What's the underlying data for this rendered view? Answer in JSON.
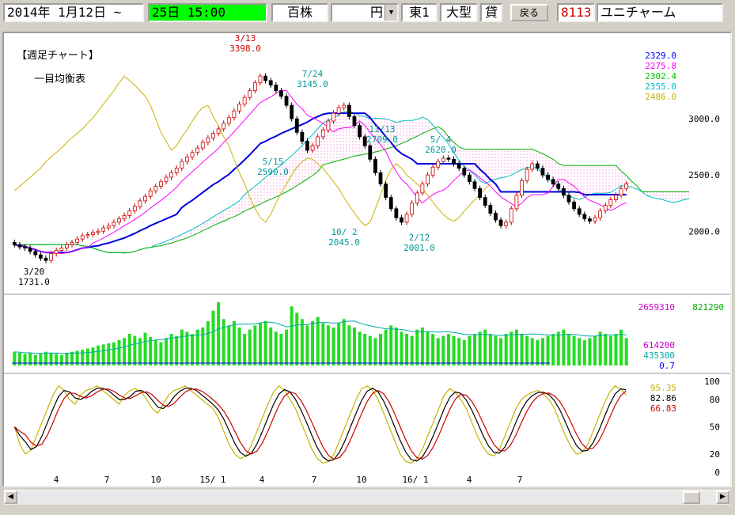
{
  "toolbar": {
    "start_date": "2014年 1月12日 ~",
    "end_date": "25日 15:00",
    "unit": "百株",
    "currency": "円",
    "market": "東1",
    "size": "大型",
    "lend": "貸",
    "back_label": "戻る",
    "code": "8113",
    "company": "ユニチャーム"
  },
  "chart_data": {
    "type": "candlestick",
    "title": "【週足チャート】",
    "subtitle": "一目均衡表",
    "price_axis": {
      "ticks": [
        "3000.0",
        "2500.0",
        "2000.0"
      ],
      "values": [
        3000,
        2500,
        2000
      ],
      "range": [
        1650,
        3550
      ]
    },
    "x_ticks": [
      "4",
      "7",
      "10",
      "15/ 1",
      "4",
      "7",
      "10",
      "16/ 1",
      "4",
      "7"
    ],
    "price_legend": [
      {
        "value": "2329.0",
        "color": "#0000ff"
      },
      {
        "value": "2275.8",
        "color": "#ff00ff"
      },
      {
        "value": "2302.4",
        "color": "#00c000"
      },
      {
        "value": "2355.0",
        "color": "#00c0c0"
      },
      {
        "value": "2486.0",
        "color": "#c8b400"
      }
    ],
    "annotations": [
      {
        "date": "3/13",
        "price": "3398.0",
        "color": "#cc0000"
      },
      {
        "date": "7/24",
        "price": "3145.0",
        "color": "#009999"
      },
      {
        "date": "11/13",
        "price": "2709.0",
        "color": "#009999"
      },
      {
        "date": "5/ 4",
        "price": "2620.0",
        "color": "#009999"
      },
      {
        "date": "5/15",
        "price": "2590.0",
        "color": "#009999"
      },
      {
        "date": "3/20",
        "price": "1731.0",
        "color": "#000000"
      },
      {
        "date": "10/ 2",
        "price": "2045.0",
        "color": "#009999"
      },
      {
        "date": "2/12",
        "price": "2001.0",
        "color": "#009999"
      }
    ],
    "volume_legend": [
      {
        "value": "2659310",
        "color": "#cc00cc"
      },
      {
        "value": "821290",
        "color": "#00aa00"
      },
      {
        "value": "614200",
        "color": "#cc00cc"
      },
      {
        "value": "435300",
        "color": "#00aaaa"
      },
      {
        "value": "0.7",
        "color": "#0000ff"
      }
    ],
    "osc_axis": {
      "ticks": [
        "100",
        "80",
        "50",
        "20",
        "0"
      ],
      "values": [
        100,
        80,
        50,
        20,
        0
      ]
    },
    "osc_legend": [
      {
        "value": "95.35",
        "color": "#c8b400"
      },
      {
        "value": "82.86",
        "color": "#000000"
      },
      {
        "value": "66.83",
        "color": "#cc0000"
      }
    ],
    "close": [
      1880,
      1860,
      1850,
      1820,
      1790,
      1760,
      1740,
      1800,
      1830,
      1850,
      1880,
      1900,
      1930,
      1960,
      1970,
      1990,
      2000,
      2030,
      2050,
      2080,
      2110,
      2140,
      2180,
      2220,
      2270,
      2310,
      2360,
      2400,
      2440,
      2480,
      2520,
      2560,
      2620,
      2660,
      2700,
      2740,
      2790,
      2830,
      2870,
      2910,
      2960,
      3010,
      3070,
      3130,
      3190,
      3250,
      3320,
      3380,
      3340,
      3300,
      3250,
      3200,
      3120,
      3000,
      2880,
      2800,
      2720,
      2760,
      2840,
      2900,
      2980,
      3050,
      3100,
      3120,
      3020,
      2940,
      2840,
      2760,
      2640,
      2520,
      2420,
      2300,
      2200,
      2120,
      2080,
      2150,
      2250,
      2340,
      2420,
      2500,
      2570,
      2620,
      2650,
      2640,
      2600,
      2560,
      2500,
      2440,
      2380,
      2300,
      2230,
      2160,
      2100,
      2050,
      2080,
      2200,
      2320,
      2450,
      2550,
      2600,
      2560,
      2500,
      2460,
      2420,
      2380,
      2320,
      2260,
      2200,
      2150,
      2110,
      2090,
      2120,
      2180,
      2230,
      2280,
      2320,
      2380,
      2420
    ],
    "volume": [
      130,
      120,
      110,
      120,
      100,
      110,
      130,
      120,
      110,
      100,
      120,
      130,
      140,
      150,
      160,
      170,
      190,
      200,
      210,
      220,
      240,
      260,
      300,
      280,
      260,
      310,
      270,
      240,
      220,
      260,
      300,
      280,
      340,
      320,
      300,
      340,
      360,
      420,
      520,
      600,
      440,
      380,
      420,
      360,
      300,
      340,
      380,
      400,
      420,
      360,
      320,
      300,
      340,
      560,
      500,
      440,
      380,
      420,
      460,
      400,
      380,
      360,
      400,
      440,
      380,
      360,
      320,
      300,
      280,
      260,
      300,
      340,
      380,
      360,
      320,
      300,
      280,
      340,
      360,
      320,
      300,
      260,
      280,
      300,
      280,
      260,
      240,
      280,
      300,
      320,
      340,
      300,
      280,
      260,
      300,
      320,
      340,
      300,
      280,
      260,
      240,
      260,
      280,
      300,
      320,
      340,
      300,
      280,
      260,
      240,
      260,
      280,
      320,
      300,
      280,
      300,
      340,
      260
    ],
    "oscillator": [
      50,
      30,
      20,
      25,
      40,
      55,
      70,
      85,
      95,
      90,
      80,
      75,
      85,
      90,
      92,
      95,
      90,
      85,
      80,
      75,
      85,
      90,
      92,
      88,
      80,
      70,
      65,
      75,
      85,
      90,
      92,
      95,
      90,
      85,
      80,
      75,
      70,
      60,
      45,
      30,
      20,
      15,
      18,
      30,
      45,
      60,
      75,
      88,
      95,
      90,
      80,
      70,
      55,
      40,
      25,
      15,
      10,
      12,
      20,
      35,
      50,
      65,
      80,
      92,
      95,
      90,
      80,
      65,
      50,
      35,
      20,
      12,
      10,
      15,
      25,
      40,
      55,
      70,
      85,
      92,
      88,
      80,
      70,
      55,
      40,
      28,
      20,
      18,
      25,
      40,
      55,
      70,
      80,
      85,
      88,
      90,
      86,
      80,
      70,
      55,
      40,
      28,
      20,
      22,
      30,
      45,
      60,
      75,
      88,
      95,
      92,
      85
    ]
  }
}
